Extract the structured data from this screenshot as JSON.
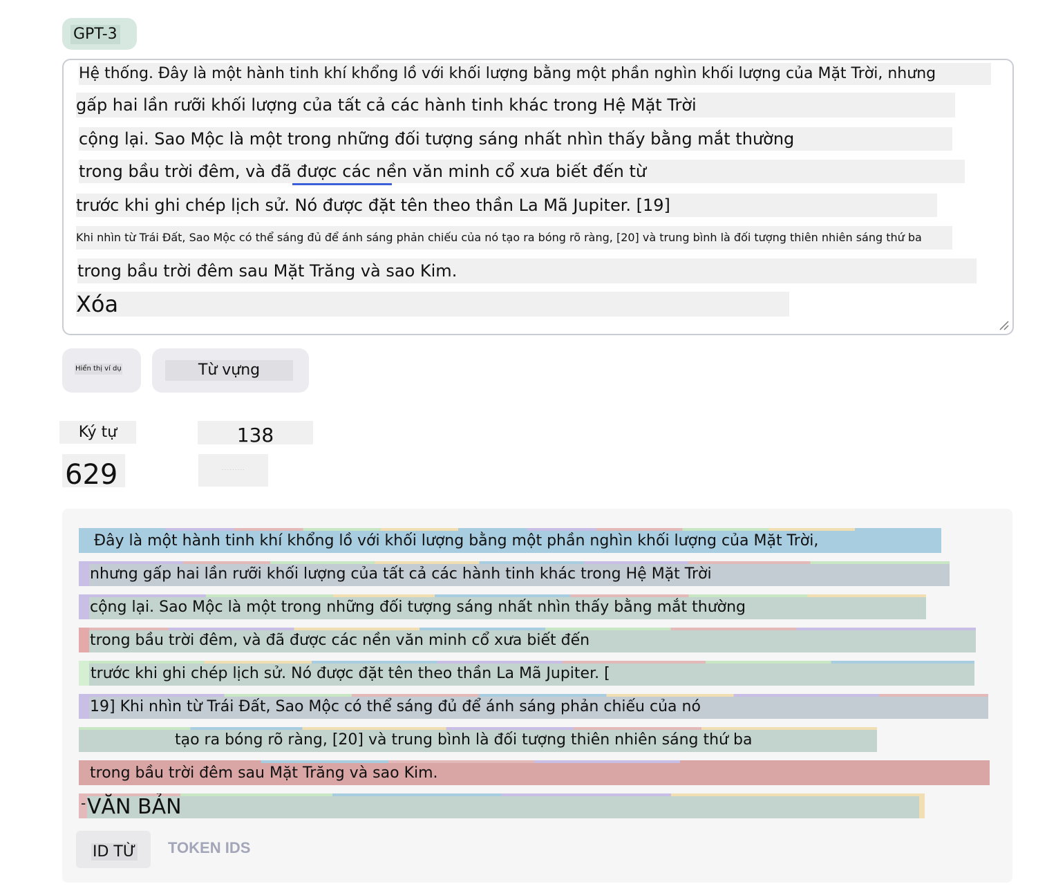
{
  "model": {
    "label": "GPT-3"
  },
  "input": {
    "lines": [
      "Hệ thống. Đây là một hành tinh khí khổng lồ với khối lượng bằng một phần nghìn khối lượng của Mặt Trời, nhưng",
      "gấp hai lần rưỡi khối lượng của tất cả các hành tinh khác trong Hệ Mặt Trời",
      "cộng lại. Sao Mộc là một trong những đối tượng sáng nhất nhìn thấy bằng mắt thường",
      "trong bầu trời đêm, và đã được các nền văn minh cổ xưa biết đến từ",
      "trước khi ghi chép lịch sử. Nó được đặt tên theo thần La Mã Jupiter. [19]",
      "Khi nhìn từ Trái Đất, Sao Mộc có thể sáng đủ để ánh sáng phản chiếu của nó tạo ra bóng rõ ràng, [20] và trung bình là đối tượng thiên nhiên sáng thứ ba",
      "trong bầu trời đêm sau Mặt Trăng và sao Kim.",
      "Xóa"
    ]
  },
  "buttons": {
    "show_example": "Hiển thị ví dụ",
    "vocabulary": "Từ vựng"
  },
  "stats": {
    "characters_label": "Ký tự",
    "tokens_value": "138",
    "characters_value": "629",
    "tokens_label": "· · · · · · · · ·"
  },
  "tokens": {
    "lines": [
      "Đây là một hành tinh khí khổng lồ với khối lượng bằng một phần nghìn khối lượng của Mặt Trời,",
      "nhưng gấp hai lần rưỡi khối lượng của tất cả các hành tinh khác trong Hệ Mặt Trời",
      "cộng lại. Sao Mộc là một trong những đối tượng sáng nhất nhìn thấy bằng mắt thường",
      "trong bầu trời đêm, và đã được các nền văn minh cổ xưa biết đến",
      "trước khi ghi chép lịch sử. Nó được đặt tên theo thần La Mã Jupiter. [",
      "19] Khi nhìn từ Trái Đất, Sao Mộc có thể sáng đủ để ánh sáng phản chiếu của nó",
      "tạo ra bóng rõ ràng, [20] và trung bình là đối tượng thiên nhiên sáng thứ ba",
      "trong bầu trời đêm sau Mặt Trăng và sao Kim.",
      "VĂN BẢN"
    ],
    "prefix_mark": "-"
  },
  "tabs": {
    "word_ids": "ID TỪ",
    "token_ids": "TOKEN IDS"
  },
  "colors": {
    "token_blue": "#a9cde0",
    "token_purple": "#c9bfe6",
    "token_grey_green": "#c3d3cd",
    "token_red": "#d9a5a5",
    "token_green": "#c9e6c4",
    "token_yellow": "#f2deb3",
    "link_underline": "#3a5fd8"
  }
}
